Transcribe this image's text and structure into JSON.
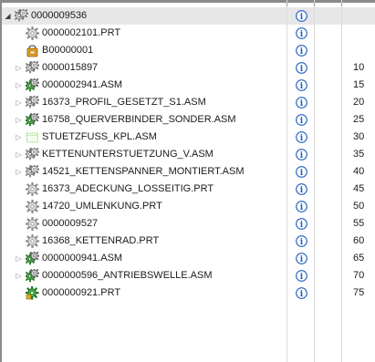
{
  "tree": {
    "rows": [
      {
        "id": "0000009536",
        "icon": "assembly-icon",
        "expand": "expanded",
        "level": 0,
        "num": ""
      },
      {
        "id": "0000002101.PRT",
        "icon": "part-icon",
        "expand": "none",
        "level": 1,
        "num": ""
      },
      {
        "id": "B00000001",
        "icon": "bulk-item-icon",
        "expand": "none",
        "level": 1,
        "num": ""
      },
      {
        "id": "0000015897",
        "icon": "assembly-icon",
        "expand": "collapsed",
        "level": 1,
        "num": "10"
      },
      {
        "id": "0000002941.ASM",
        "icon": "green-assembly-icon",
        "expand": "collapsed",
        "level": 1,
        "num": "15"
      },
      {
        "id": "16373_PROFIL_GESETZT_S1.ASM",
        "icon": "assembly-icon",
        "expand": "collapsed",
        "level": 1,
        "num": "20"
      },
      {
        "id": "16758_QUERVERBINDER_SONDER.ASM",
        "icon": "green-assembly-icon",
        "expand": "collapsed",
        "level": 1,
        "num": "25"
      },
      {
        "id": "STUETZFUSS_KPL.ASM",
        "icon": "placeholder-icon",
        "expand": "collapsed",
        "level": 1,
        "num": "30"
      },
      {
        "id": "KETTENUNTERSTUETZUNG_V.ASM",
        "icon": "assembly-icon",
        "expand": "collapsed",
        "level": 1,
        "num": "35"
      },
      {
        "id": "14521_KETTENSPANNER_MONTIERT.ASM",
        "icon": "assembly-icon",
        "expand": "collapsed",
        "level": 1,
        "num": "40"
      },
      {
        "id": "16373_ADECKUNG_LOSSEITIG.PRT",
        "icon": "part-icon",
        "expand": "none",
        "level": 1,
        "num": "45"
      },
      {
        "id": "14720_UMLENKUNG.PRT",
        "icon": "part-icon",
        "expand": "none",
        "level": 1,
        "num": "50"
      },
      {
        "id": "0000009527",
        "icon": "part-icon",
        "expand": "none",
        "level": 1,
        "num": "55"
      },
      {
        "id": "16368_KETTENRAD.PRT",
        "icon": "part-icon",
        "expand": "none",
        "level": 1,
        "num": "60"
      },
      {
        "id": "0000000941.ASM",
        "icon": "green-assembly-icon",
        "expand": "collapsed",
        "level": 1,
        "num": "65"
      },
      {
        "id": "0000000596_ANTRIEBSWELLE.ASM",
        "icon": "green-assembly-icon",
        "expand": "collapsed",
        "level": 1,
        "num": "70"
      },
      {
        "id": "0000000921.PRT",
        "icon": "green-part-icon",
        "expand": "none",
        "level": 1,
        "num": "75"
      }
    ]
  },
  "glyphs": {
    "expanded": "◢",
    "collapsed": "▷",
    "info": "i"
  },
  "colors": {
    "selected_row": "#e7e7e7",
    "info_blue": "#1f5fbf",
    "gear_gray": "#8c8c8c",
    "assembly_green": "#3a9a3a",
    "placeholder_green": "#9bd27a"
  }
}
